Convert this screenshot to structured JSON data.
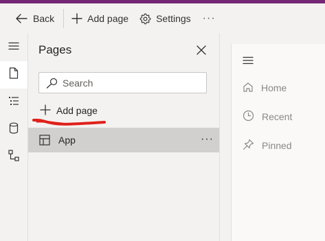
{
  "toolbar": {
    "back_label": "Back",
    "add_page_label": "Add page",
    "settings_label": "Settings",
    "more_label": "···"
  },
  "rail": {
    "items": [
      {
        "icon": "hamburger-icon"
      },
      {
        "icon": "page-icon",
        "active": true
      },
      {
        "icon": "tree-view-icon"
      },
      {
        "icon": "database-icon"
      },
      {
        "icon": "flow-icon"
      }
    ]
  },
  "pages_panel": {
    "title": "Pages",
    "search_placeholder": "Search",
    "search_value": "",
    "add_page_label": "Add page",
    "items": [
      {
        "label": "App",
        "icon": "app-layout-icon",
        "more_label": "···",
        "selected": true
      }
    ]
  },
  "canvas": {
    "nav_items": [
      {
        "label": "Home",
        "icon": "home-icon"
      },
      {
        "label": "Recent",
        "icon": "clock-icon"
      },
      {
        "label": "Pinned",
        "icon": "pin-icon"
      }
    ]
  },
  "colors": {
    "accent_bar": "#742774",
    "selected_row": "#d2d0ce",
    "annotation_red": "#e0201b"
  }
}
